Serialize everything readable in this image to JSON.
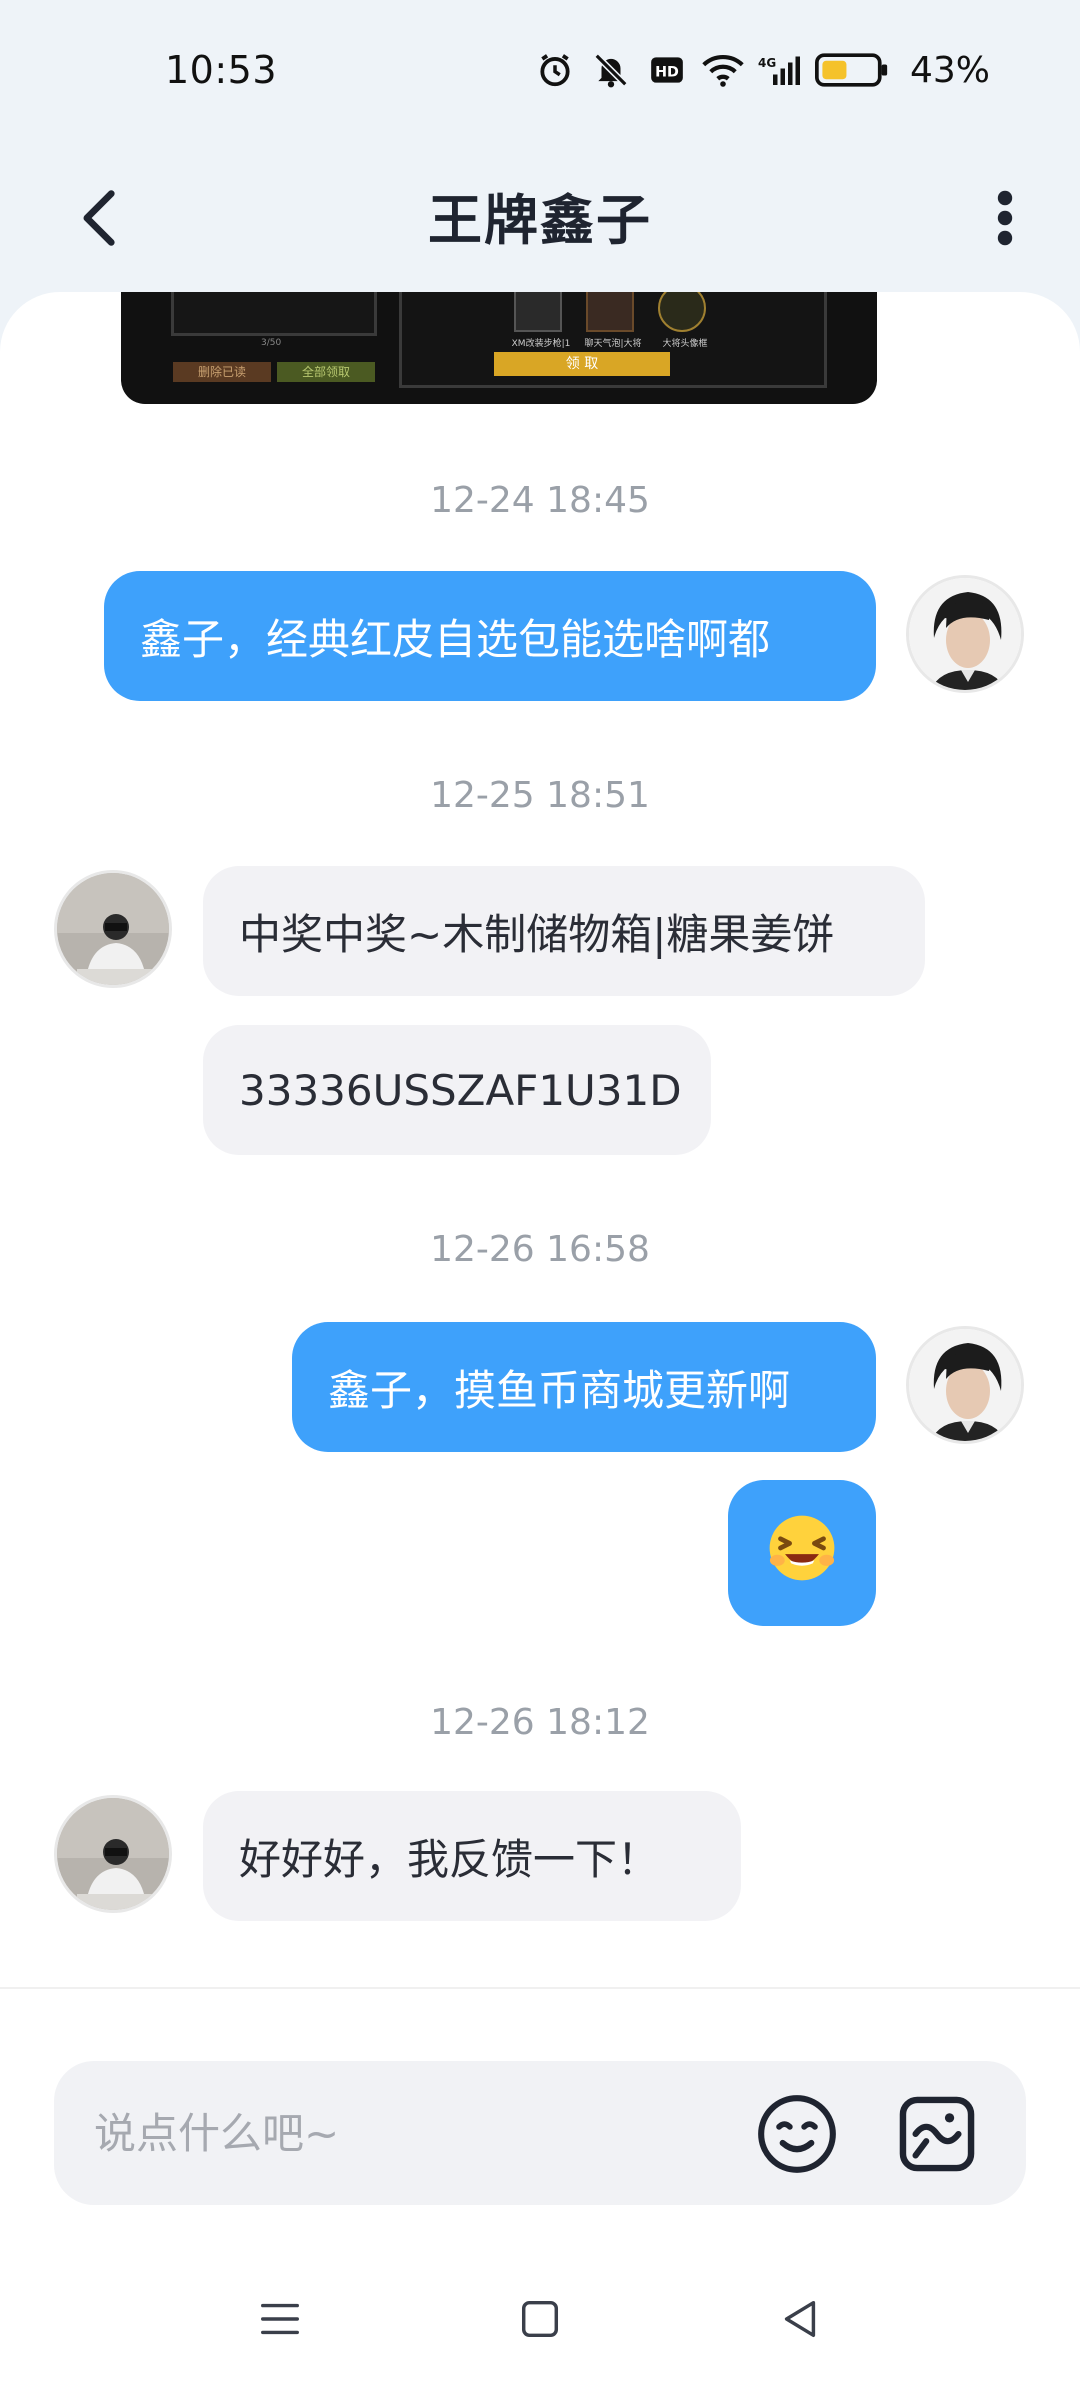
{
  "status_bar": {
    "time": "10:53",
    "battery": "43%",
    "icons": [
      "alarm-icon",
      "mute-icon",
      "hd-icon",
      "wifi-icon",
      "signal-4g-icon",
      "battery-icon"
    ]
  },
  "header": {
    "title": "王牌鑫子"
  },
  "previous_image": {
    "left_buttons": [
      "删除已读",
      "全部领取"
    ],
    "page": "3/50",
    "items": [
      "XM改装步枪|1",
      "聊天气泡|大将",
      "大将头像框"
    ],
    "claim_button": "领 取"
  },
  "messages": [
    {
      "type": "timestamp",
      "text": "12-24 18:45"
    },
    {
      "type": "outgoing",
      "text": "鑫子，经典红皮自选包能选啥啊都"
    },
    {
      "type": "timestamp",
      "text": "12-25 18:51"
    },
    {
      "type": "incoming",
      "text": "中奖中奖~木制储物箱|糖果姜饼"
    },
    {
      "type": "incoming",
      "text": "33336USSZAF1U31D"
    },
    {
      "type": "timestamp",
      "text": "12-26 16:58"
    },
    {
      "type": "outgoing",
      "text": "鑫子，摸鱼币商城更新啊"
    },
    {
      "type": "outgoing",
      "text": "😆",
      "emoji": "laughing-face"
    },
    {
      "type": "timestamp",
      "text": "12-26 18:12"
    },
    {
      "type": "incoming",
      "text": "好好好，我反馈一下！"
    }
  ],
  "input": {
    "placeholder": "说点什么吧~"
  },
  "colors": {
    "outgoing_bubble": "#3ea1fb",
    "incoming_bubble": "#f2f2f5",
    "background": "#eef3f8"
  }
}
